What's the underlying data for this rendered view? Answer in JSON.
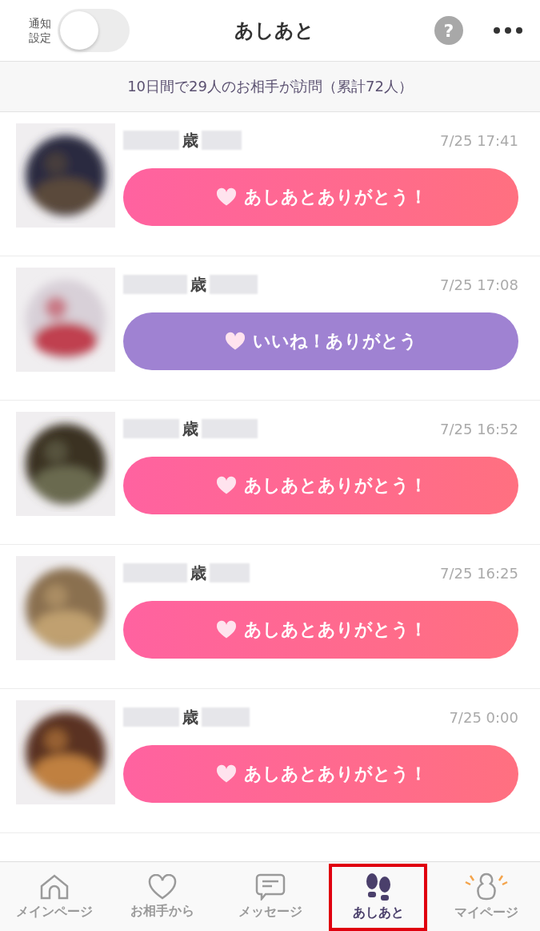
{
  "header": {
    "notify_label": "通知設定",
    "notify_toggle": {
      "on": false
    },
    "title": "あしあと",
    "help": "?"
  },
  "summary": "10日間で29人のお相手が訪問（累計72人）",
  "visitors": [
    {
      "age_label": "歳",
      "time": "7/25 17:41",
      "button": {
        "kind": "ashiato",
        "label": "あしあとありがとう！"
      }
    },
    {
      "age_label": "歳",
      "time": "7/25 17:08",
      "button": {
        "kind": "iine",
        "label": "いいね！ありがとう"
      }
    },
    {
      "age_label": "歳",
      "time": "7/25 16:52",
      "button": {
        "kind": "ashiato",
        "label": "あしあとありがとう！"
      }
    },
    {
      "age_label": "歳",
      "time": "7/25 16:25",
      "button": {
        "kind": "ashiato",
        "label": "あしあとありがとう！"
      }
    },
    {
      "age_label": "歳",
      "time": "7/25 0:00",
      "button": {
        "kind": "ashiato",
        "label": "あしあとありがとう！"
      }
    }
  ],
  "tabs": [
    {
      "kind": "home",
      "label": "メインページ",
      "selected": false
    },
    {
      "kind": "heart",
      "label": "お相手から",
      "selected": false
    },
    {
      "kind": "message",
      "label": "メッセージ",
      "selected": false
    },
    {
      "kind": "footprints",
      "label": "あしあと",
      "selected": true
    },
    {
      "kind": "mypage",
      "label": "マイページ",
      "selected": false
    }
  ]
}
